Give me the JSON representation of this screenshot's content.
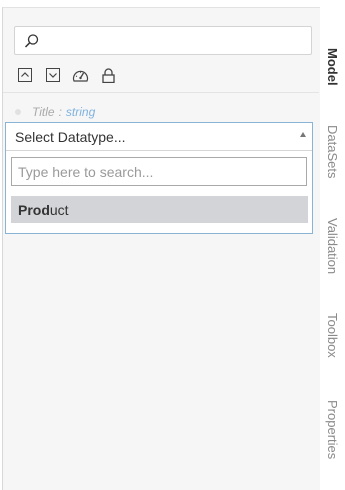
{
  "search": {
    "placeholder": "",
    "icon": "search-icon"
  },
  "toolbar": {
    "icons": [
      "collapse-all-icon",
      "expand-all-icon",
      "speedometer-icon",
      "lock-icon"
    ]
  },
  "property": {
    "name": "Title",
    "separator": ":",
    "type": "string"
  },
  "dropdown": {
    "label": "Select Datatype...",
    "filter_placeholder": "Type here to search...",
    "results": [
      {
        "match": "Prod",
        "rest": "uct"
      }
    ]
  },
  "sidebar": {
    "tabs": [
      {
        "label": "Model",
        "active": true
      },
      {
        "label": "DataSets",
        "active": false
      },
      {
        "label": "Validation",
        "active": false
      },
      {
        "label": "Toolbox",
        "active": false
      },
      {
        "label": "Properties",
        "active": false
      }
    ]
  },
  "colors": {
    "accent_border": "#8ab4d6",
    "type_text": "#7fb2de",
    "highlight": "#d2d4d7"
  }
}
